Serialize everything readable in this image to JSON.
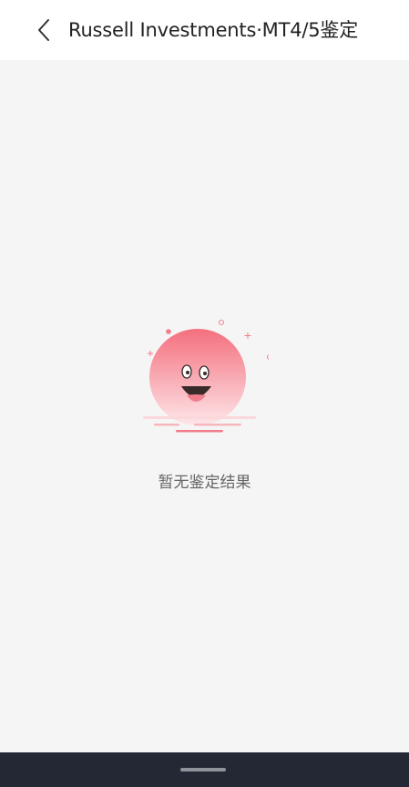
{
  "header": {
    "back_icon": "chevron-left-icon",
    "title": "Russell Investments·MT4/5鉴定"
  },
  "empty_state": {
    "illustration_icon": "smiling-sun-icon",
    "message": "暂无鉴定结果"
  },
  "colors": {
    "header_bg": "#ffffff",
    "page_bg": "#f5f5f5",
    "accent_pink": "#f27d8a",
    "navbar_bg": "#232834"
  }
}
